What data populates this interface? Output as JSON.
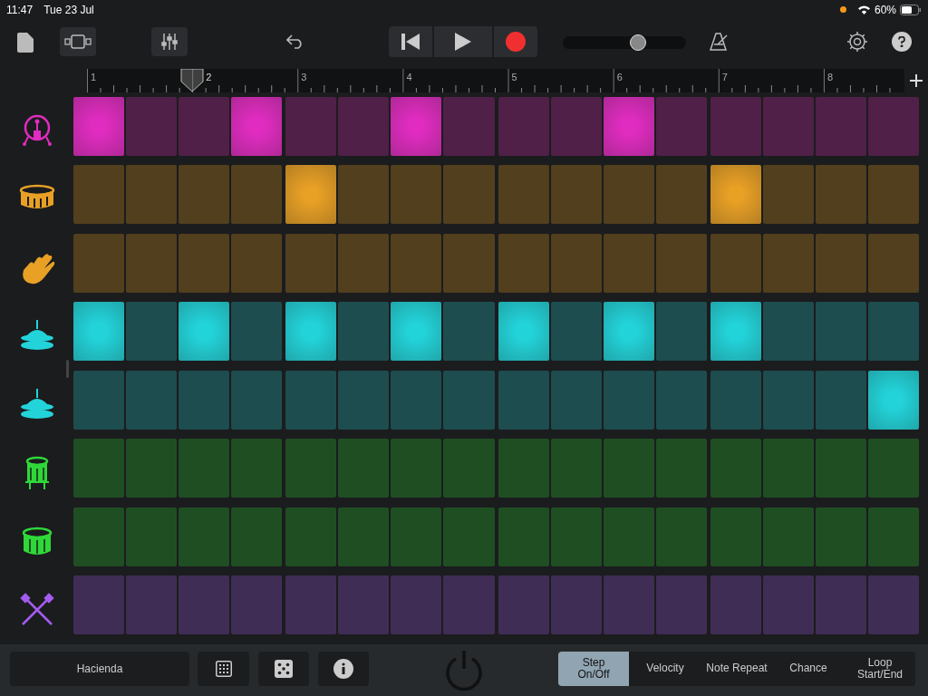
{
  "status_bar": {
    "time": "11:47",
    "date": "Tue 23 Jul",
    "battery": "60%"
  },
  "toolbar": {
    "tempo_slider": {
      "level": 0.61
    }
  },
  "ruler": {
    "bars": [
      {
        "label": "1",
        "playhead": false
      },
      {
        "label": "2",
        "playhead": true
      },
      {
        "label": "3",
        "playhead": false
      },
      {
        "label": "4",
        "playhead": false
      },
      {
        "label": "5",
        "playhead": false
      },
      {
        "label": "6",
        "playhead": false
      },
      {
        "label": "7",
        "playhead": false
      },
      {
        "label": "8",
        "playhead": false
      }
    ]
  },
  "tracks": [
    {
      "kind": "kick",
      "color": "#e02cc0",
      "steps": [
        true,
        false,
        false,
        true,
        false,
        false,
        true,
        false,
        false,
        false,
        true,
        false,
        false,
        false,
        false,
        false
      ]
    },
    {
      "kind": "snare",
      "color": "#e8a025",
      "steps": [
        false,
        false,
        false,
        false,
        true,
        false,
        false,
        false,
        false,
        false,
        false,
        false,
        true,
        false,
        false,
        false
      ]
    },
    {
      "kind": "clap",
      "color": "#e8a025",
      "steps": [
        false,
        false,
        false,
        false,
        false,
        false,
        false,
        false,
        false,
        false,
        false,
        false,
        false,
        false,
        false,
        false
      ]
    },
    {
      "kind": "hihat",
      "color": "#22d4da",
      "steps": [
        true,
        false,
        true,
        false,
        true,
        false,
        true,
        false,
        true,
        false,
        true,
        false,
        true,
        false,
        false,
        false
      ]
    },
    {
      "kind": "hihat",
      "color": "#22d4da",
      "steps": [
        false,
        false,
        false,
        false,
        false,
        false,
        false,
        false,
        false,
        false,
        false,
        false,
        false,
        false,
        false,
        true
      ]
    },
    {
      "kind": "tom",
      "color": "#2ed838",
      "steps": [
        false,
        false,
        false,
        false,
        false,
        false,
        false,
        false,
        false,
        false,
        false,
        false,
        false,
        false,
        false,
        false
      ]
    },
    {
      "kind": "drum",
      "color": "#2ed838",
      "steps": [
        false,
        false,
        false,
        false,
        false,
        false,
        false,
        false,
        false,
        false,
        false,
        false,
        false,
        false,
        false,
        false
      ]
    },
    {
      "kind": "sticks",
      "color": "#a45cf0",
      "steps": [
        false,
        false,
        false,
        false,
        false,
        false,
        false,
        false,
        false,
        false,
        false,
        false,
        false,
        false,
        false,
        false
      ]
    }
  ],
  "bottom_bar": {
    "pattern_name": "Hacienda",
    "modes": [
      {
        "label": "Step\nOn/Off",
        "selected": true
      },
      {
        "label": "Velocity",
        "selected": false
      },
      {
        "label": "Note Repeat",
        "selected": false
      },
      {
        "label": "Chance",
        "selected": false
      },
      {
        "label": "Loop\nStart/End",
        "selected": false
      }
    ]
  }
}
